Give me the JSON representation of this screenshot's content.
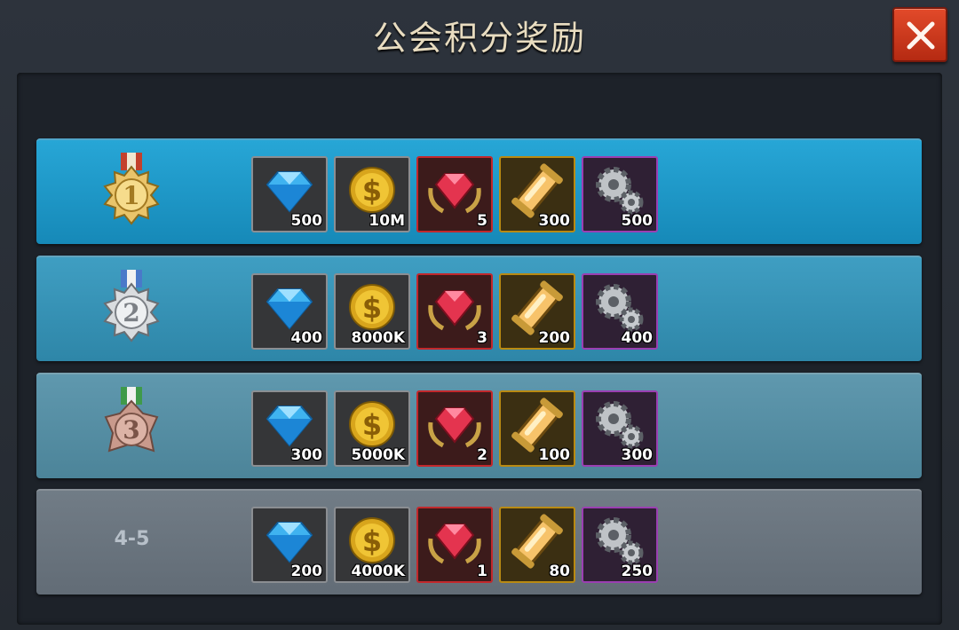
{
  "title": "公会积分奖励",
  "colors": {
    "close_button": "#d63a1e",
    "title_text": "#e8dcc0"
  },
  "rows": [
    {
      "rank": "1",
      "medal": "gold-medal-icon",
      "diamond": "500",
      "gold": "10M",
      "ruby": "5",
      "ammo": "300",
      "parts": "500"
    },
    {
      "rank": "2",
      "medal": "silver-medal-icon",
      "diamond": "400",
      "gold": "8000K",
      "ruby": "3",
      "ammo": "200",
      "parts": "400"
    },
    {
      "rank": "3",
      "medal": "bronze-medal-icon",
      "diamond": "300",
      "gold": "5000K",
      "ruby": "2",
      "ammo": "100",
      "parts": "300"
    },
    {
      "rank": "4-5",
      "diamond": "200",
      "gold": "4000K",
      "ruby": "1",
      "ammo": "80",
      "parts": "250"
    }
  ]
}
